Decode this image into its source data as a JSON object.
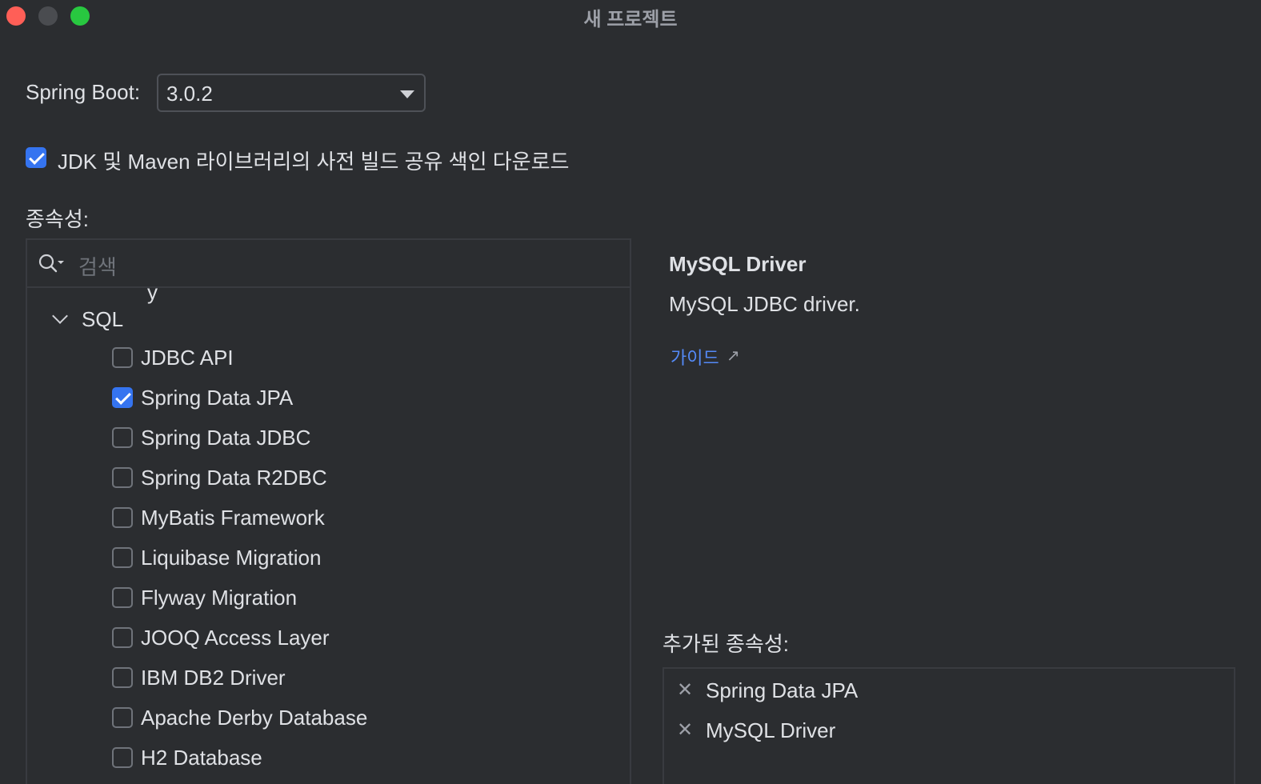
{
  "window": {
    "title": "새 프로젝트",
    "buttons": [
      "close",
      "minimize",
      "maximize"
    ]
  },
  "spring_boot": {
    "label": "Spring Boot:",
    "selected": "3.0.2",
    "icon": "chevron-down-icon"
  },
  "index_option": {
    "label": "JDK 및 Maven 라이브러리의 사전 빌드 공유 색인 다운로드",
    "checked": true
  },
  "dependencies": {
    "label": "종속성:",
    "search_placeholder": "검색",
    "search_icon": "search-icon",
    "group": {
      "name": "SQL",
      "expanded": true,
      "items": [
        {
          "label": "JDBC API",
          "checked": false
        },
        {
          "label": "Spring Data JPA",
          "checked": true
        },
        {
          "label": "Spring Data JDBC",
          "checked": false
        },
        {
          "label": "Spring Data R2DBC",
          "checked": false
        },
        {
          "label": "MyBatis Framework",
          "checked": false
        },
        {
          "label": "Liquibase Migration",
          "checked": false
        },
        {
          "label": "Flyway Migration",
          "checked": false
        },
        {
          "label": "JOOQ Access Layer",
          "checked": false
        },
        {
          "label": "IBM DB2 Driver",
          "checked": false
        },
        {
          "label": "Apache Derby Database",
          "checked": false
        },
        {
          "label": "H2 Database",
          "checked": false
        }
      ]
    }
  },
  "detail": {
    "title": "MySQL Driver",
    "description": "MySQL JDBC driver.",
    "guide_link": "가이드",
    "guide_icon": "external-link-icon"
  },
  "added": {
    "label": "추가된 종속성:",
    "items": [
      "Spring Data JPA",
      "MySQL Driver"
    ]
  },
  "colors": {
    "background": "#2b2d30",
    "accent": "#3574f0",
    "link": "#548af7",
    "close": "#ff5f57",
    "maximize": "#28c840"
  }
}
